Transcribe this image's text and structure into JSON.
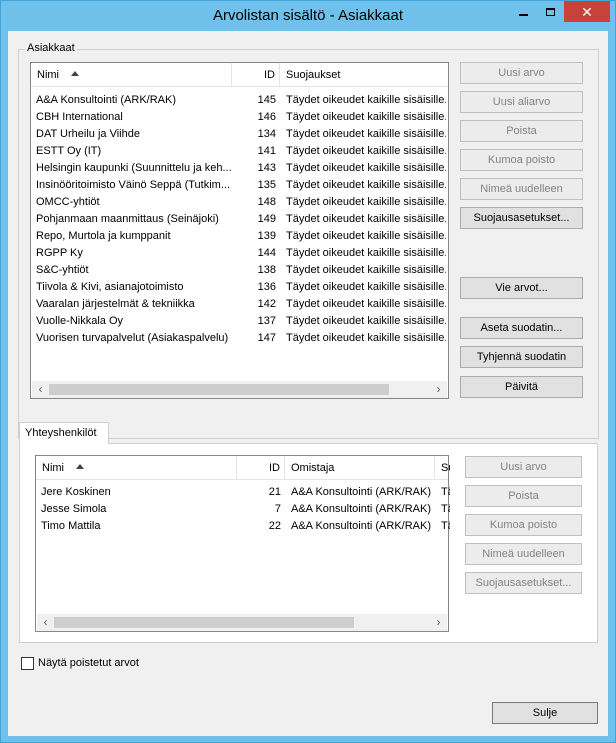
{
  "window": {
    "title": "Arvolistan sisältö - Asiakkaat",
    "close_glyph": "✕"
  },
  "customers": {
    "group_label": "Asiakkaat",
    "columns": {
      "name": "Nimi",
      "id": "ID",
      "protection": "Suojaukset"
    },
    "rows": [
      {
        "name": "A&A Konsultointi (ARK/RAK)",
        "id": "145",
        "protection": "Täydet oikeudet kaikille sisäisille..."
      },
      {
        "name": "CBH International",
        "id": "146",
        "protection": "Täydet oikeudet kaikille sisäisille..."
      },
      {
        "name": "DAT Urheilu ja Viihde",
        "id": "134",
        "protection": "Täydet oikeudet kaikille sisäisille..."
      },
      {
        "name": "ESTT Oy (IT)",
        "id": "141",
        "protection": "Täydet oikeudet kaikille sisäisille..."
      },
      {
        "name": "Helsingin kaupunki (Suunnittelu ja keh...",
        "id": "143",
        "protection": "Täydet oikeudet kaikille sisäisille..."
      },
      {
        "name": "Insinööritoimisto Väinö Seppä (Tutkim...",
        "id": "135",
        "protection": "Täydet oikeudet kaikille sisäisille..."
      },
      {
        "name": "OMCC-yhtiöt",
        "id": "148",
        "protection": "Täydet oikeudet kaikille sisäisille..."
      },
      {
        "name": "Pohjanmaan maanmittaus (Seinäjoki)",
        "id": "149",
        "protection": "Täydet oikeudet kaikille sisäisille..."
      },
      {
        "name": "Repo, Murtola ja kumppanit",
        "id": "139",
        "protection": "Täydet oikeudet kaikille sisäisille..."
      },
      {
        "name": "RGPP Ky",
        "id": "144",
        "protection": "Täydet oikeudet kaikille sisäisille..."
      },
      {
        "name": "S&C-yhtiöt",
        "id": "138",
        "protection": "Täydet oikeudet kaikille sisäisille..."
      },
      {
        "name": "Tiivola & Kivi, asianajotoimisto",
        "id": "136",
        "protection": "Täydet oikeudet kaikille sisäisille..."
      },
      {
        "name": "Vaaralan järjestelmät & tekniikka",
        "id": "142",
        "protection": "Täydet oikeudet kaikille sisäisille..."
      },
      {
        "name": "Vuolle-Nikkala Oy",
        "id": "137",
        "protection": "Täydet oikeudet kaikille sisäisille..."
      },
      {
        "name": "Vuorisen turvapalvelut (Asiakaspalvelu)",
        "id": "147",
        "protection": "Täydet oikeudet kaikille sisäisille..."
      }
    ],
    "buttons": {
      "new_value": "Uusi arvo",
      "new_subvalue": "Uusi aliarvo",
      "delete": "Poista",
      "undo_delete": "Kumoa poisto",
      "rename": "Nimeä uudelleen",
      "protection_settings": "Suojausasetukset...",
      "export_values": "Vie arvot...",
      "set_filter": "Aseta suodatin...",
      "clear_filter": "Tyhjennä suodatin",
      "refresh": "Päivitä"
    }
  },
  "contacts": {
    "tab_label": "Yhteyshenkilöt",
    "columns": {
      "name": "Nimi",
      "id": "ID",
      "owner": "Omistaja",
      "protection": "Su"
    },
    "rows": [
      {
        "name": "Jere Koskinen",
        "id": "21",
        "owner": "A&A Konsultointi (ARK/RAK)",
        "protection": "Tä"
      },
      {
        "name": "Jesse Simola",
        "id": "7",
        "owner": "A&A Konsultointi (ARK/RAK)",
        "protection": "Tä"
      },
      {
        "name": "Timo Mattila",
        "id": "22",
        "owner": "A&A Konsultointi (ARK/RAK)",
        "protection": "Tä"
      }
    ],
    "buttons": {
      "new_value": "Uusi arvo",
      "delete": "Poista",
      "undo_delete": "Kumoa poisto",
      "rename": "Nimeä uudelleen",
      "protection_settings": "Suojausasetukset..."
    }
  },
  "show_deleted_label": "Näytä poistetut arvot",
  "close_button_label": "Sulje",
  "selected_customer_index": 0
}
